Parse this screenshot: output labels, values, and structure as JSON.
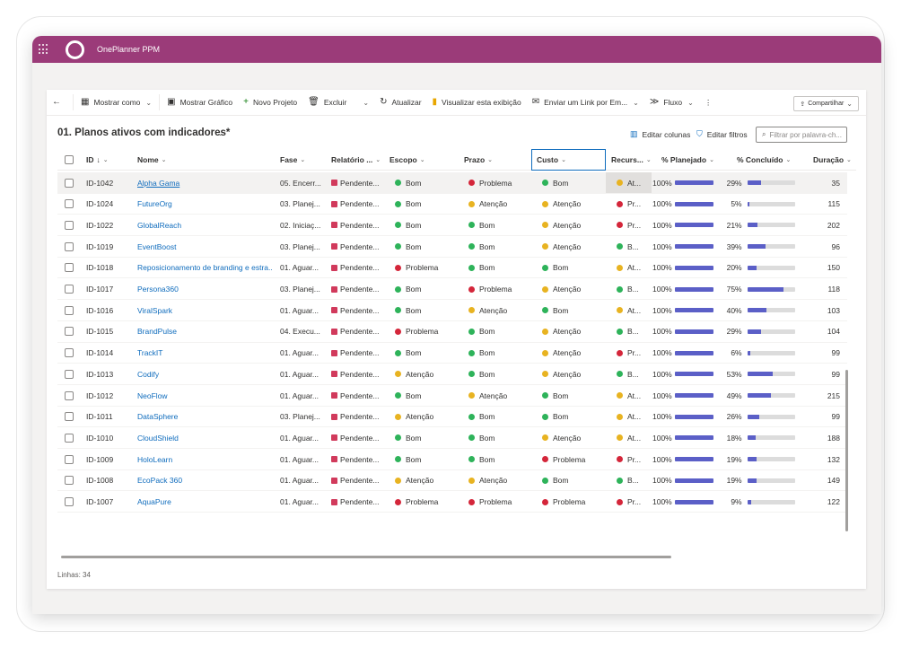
{
  "app": {
    "title": "OnePlanner PPM"
  },
  "toolbar": {
    "view_as": "Mostrar como",
    "show_chart": "Mostrar Gráfico",
    "new_project": "Novo Projeto",
    "delete": "Excluir",
    "refresh": "Atualizar",
    "visualize": "Visualizar esta exibição",
    "send_link": "Enviar um Link por Em...",
    "flow": "Fluxo",
    "share": "Compartilhar"
  },
  "view": {
    "title": "01. Planos ativos com indicadores*",
    "edit_columns": "Editar colunas",
    "edit_filters": "Editar filtros",
    "filter_placeholder": "Filtrar por palavra-ch..."
  },
  "columns": {
    "id": "ID",
    "id_sort": "↓",
    "name": "Nome",
    "phase": "Fase",
    "report": "Relatório ...",
    "scope": "Escopo",
    "schedule": "Prazo",
    "cost": "Custo",
    "resources": "Recurs...",
    "planned": "% Planejado",
    "completed": "% Concluído",
    "duration": "Duração"
  },
  "status_colors": {
    "bom": "#2eb35a",
    "atencao": "#e8b321",
    "problema": "#d4263a",
    "report": "#d13a5c",
    "bar": "#5b5fc7"
  },
  "rows": [
    {
      "id": "ID-1042",
      "name": "Alpha Gama",
      "phase": "05. Encerr...",
      "report": "Pendente...",
      "scope": "Bom",
      "scope_s": "bom",
      "schedule": "Problema",
      "schedule_s": "problema",
      "cost": "Bom",
      "cost_s": "bom",
      "resources": "At...",
      "res_s": "atencao",
      "planned": "100%",
      "planned_v": 100,
      "completed": "29%",
      "completed_v": 29,
      "duration": "35"
    },
    {
      "id": "ID-1024",
      "name": "FutureOrg",
      "phase": "03. Planej...",
      "report": "Pendente...",
      "scope": "Bom",
      "scope_s": "bom",
      "schedule": "Atenção",
      "schedule_s": "atencao",
      "cost": "Atenção",
      "cost_s": "atencao",
      "resources": "Pr...",
      "res_s": "problema",
      "planned": "100%",
      "planned_v": 100,
      "completed": "5%",
      "completed_v": 5,
      "duration": "115"
    },
    {
      "id": "ID-1022",
      "name": "GlobalReach",
      "phase": "02. Iniciaç...",
      "report": "Pendente...",
      "scope": "Bom",
      "scope_s": "bom",
      "schedule": "Bom",
      "schedule_s": "bom",
      "cost": "Atenção",
      "cost_s": "atencao",
      "resources": "Pr...",
      "res_s": "problema",
      "planned": "100%",
      "planned_v": 100,
      "completed": "21%",
      "completed_v": 21,
      "duration": "202"
    },
    {
      "id": "ID-1019",
      "name": "EventBoost",
      "phase": "03. Planej...",
      "report": "Pendente...",
      "scope": "Bom",
      "scope_s": "bom",
      "schedule": "Bom",
      "schedule_s": "bom",
      "cost": "Atenção",
      "cost_s": "atencao",
      "resources": "B...",
      "res_s": "bom",
      "planned": "100%",
      "planned_v": 100,
      "completed": "39%",
      "completed_v": 39,
      "duration": "96"
    },
    {
      "id": "ID-1018",
      "name": "Reposicionamento de branding e estra...",
      "phase": "01. Aguar...",
      "report": "Pendente...",
      "scope": "Problema",
      "scope_s": "problema",
      "schedule": "Bom",
      "schedule_s": "bom",
      "cost": "Bom",
      "cost_s": "bom",
      "resources": "At...",
      "res_s": "atencao",
      "planned": "100%",
      "planned_v": 100,
      "completed": "20%",
      "completed_v": 20,
      "duration": "150"
    },
    {
      "id": "ID-1017",
      "name": "Persona360",
      "phase": "03. Planej...",
      "report": "Pendente...",
      "scope": "Bom",
      "scope_s": "bom",
      "schedule": "Problema",
      "schedule_s": "problema",
      "cost": "Atenção",
      "cost_s": "atencao",
      "resources": "B...",
      "res_s": "bom",
      "planned": "100%",
      "planned_v": 100,
      "completed": "75%",
      "completed_v": 75,
      "duration": "118"
    },
    {
      "id": "ID-1016",
      "name": "ViralSpark",
      "phase": "01. Aguar...",
      "report": "Pendente...",
      "scope": "Bom",
      "scope_s": "bom",
      "schedule": "Atenção",
      "schedule_s": "atencao",
      "cost": "Bom",
      "cost_s": "bom",
      "resources": "At...",
      "res_s": "atencao",
      "planned": "100%",
      "planned_v": 100,
      "completed": "40%",
      "completed_v": 40,
      "duration": "103"
    },
    {
      "id": "ID-1015",
      "name": "BrandPulse",
      "phase": "04. Execu...",
      "report": "Pendente...",
      "scope": "Problema",
      "scope_s": "problema",
      "schedule": "Bom",
      "schedule_s": "bom",
      "cost": "Atenção",
      "cost_s": "atencao",
      "resources": "B...",
      "res_s": "bom",
      "planned": "100%",
      "planned_v": 100,
      "completed": "29%",
      "completed_v": 29,
      "duration": "104"
    },
    {
      "id": "ID-1014",
      "name": "TrackIT",
      "phase": "01. Aguar...",
      "report": "Pendente...",
      "scope": "Bom",
      "scope_s": "bom",
      "schedule": "Bom",
      "schedule_s": "bom",
      "cost": "Atenção",
      "cost_s": "atencao",
      "resources": "Pr...",
      "res_s": "problema",
      "planned": "100%",
      "planned_v": 100,
      "completed": "6%",
      "completed_v": 6,
      "duration": "99"
    },
    {
      "id": "ID-1013",
      "name": "Codify",
      "phase": "01. Aguar...",
      "report": "Pendente...",
      "scope": "Atenção",
      "scope_s": "atencao",
      "schedule": "Bom",
      "schedule_s": "bom",
      "cost": "Atenção",
      "cost_s": "atencao",
      "resources": "B...",
      "res_s": "bom",
      "planned": "100%",
      "planned_v": 100,
      "completed": "53%",
      "completed_v": 53,
      "duration": "99"
    },
    {
      "id": "ID-1012",
      "name": "NeoFlow",
      "phase": "01. Aguar...",
      "report": "Pendente...",
      "scope": "Bom",
      "scope_s": "bom",
      "schedule": "Atenção",
      "schedule_s": "atencao",
      "cost": "Bom",
      "cost_s": "bom",
      "resources": "At...",
      "res_s": "atencao",
      "planned": "100%",
      "planned_v": 100,
      "completed": "49%",
      "completed_v": 49,
      "duration": "215"
    },
    {
      "id": "ID-1011",
      "name": "DataSphere",
      "phase": "03. Planej...",
      "report": "Pendente...",
      "scope": "Atenção",
      "scope_s": "atencao",
      "schedule": "Bom",
      "schedule_s": "bom",
      "cost": "Bom",
      "cost_s": "bom",
      "resources": "At...",
      "res_s": "atencao",
      "planned": "100%",
      "planned_v": 100,
      "completed": "26%",
      "completed_v": 26,
      "duration": "99"
    },
    {
      "id": "ID-1010",
      "name": "CloudShield",
      "phase": "01. Aguar...",
      "report": "Pendente...",
      "scope": "Bom",
      "scope_s": "bom",
      "schedule": "Bom",
      "schedule_s": "bom",
      "cost": "Atenção",
      "cost_s": "atencao",
      "resources": "At...",
      "res_s": "atencao",
      "planned": "100%",
      "planned_v": 100,
      "completed": "18%",
      "completed_v": 18,
      "duration": "188"
    },
    {
      "id": "ID-1009",
      "name": "HoloLearn",
      "phase": "01. Aguar...",
      "report": "Pendente...",
      "scope": "Bom",
      "scope_s": "bom",
      "schedule": "Bom",
      "schedule_s": "bom",
      "cost": "Problema",
      "cost_s": "problema",
      "resources": "Pr...",
      "res_s": "problema",
      "planned": "100%",
      "planned_v": 100,
      "completed": "19%",
      "completed_v": 19,
      "duration": "132"
    },
    {
      "id": "ID-1008",
      "name": "EcoPack 360",
      "phase": "01. Aguar...",
      "report": "Pendente...",
      "scope": "Atenção",
      "scope_s": "atencao",
      "schedule": "Atenção",
      "schedule_s": "atencao",
      "cost": "Bom",
      "cost_s": "bom",
      "resources": "B...",
      "res_s": "bom",
      "planned": "100%",
      "planned_v": 100,
      "completed": "19%",
      "completed_v": 19,
      "duration": "149"
    },
    {
      "id": "ID-1007",
      "name": "AquaPure",
      "phase": "01. Aguar...",
      "report": "Pendente...",
      "scope": "Problema",
      "scope_s": "problema",
      "schedule": "Problema",
      "schedule_s": "problema",
      "cost": "Problema",
      "cost_s": "problema",
      "resources": "Pr...",
      "res_s": "problema",
      "planned": "100%",
      "planned_v": 100,
      "completed": "9%",
      "completed_v": 9,
      "duration": "122"
    }
  ],
  "footer": {
    "rows_label": "Linhas: 34"
  }
}
